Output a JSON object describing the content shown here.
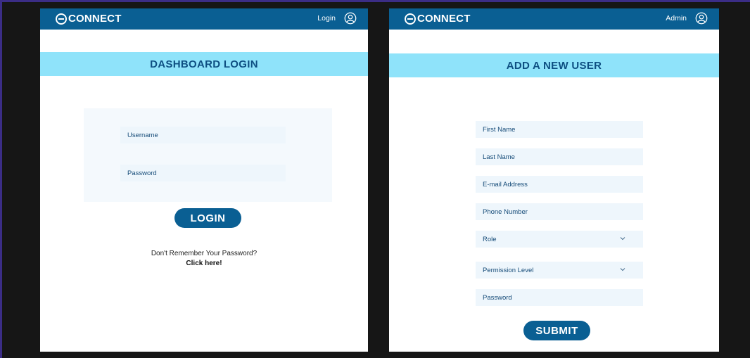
{
  "brand": {
    "logo_text": "CONNECT"
  },
  "login_screen": {
    "nav_label": "Login",
    "title": "DASHBOARD LOGIN",
    "username_placeholder": "Username",
    "password_placeholder": "Password",
    "login_button": "LOGIN",
    "forgot_prompt": "Don't Remember Your Password?",
    "forgot_link": "Click here!"
  },
  "add_user_screen": {
    "nav_label": "Admin",
    "title": "ADD A NEW USER",
    "fields": [
      {
        "label": "First Name",
        "type": "text"
      },
      {
        "label": "Last Name",
        "type": "text"
      },
      {
        "label": "E-mail Address",
        "type": "text"
      },
      {
        "label": "Phone Number",
        "type": "text"
      },
      {
        "label": "Role",
        "type": "select"
      },
      {
        "label": "Permission Level",
        "type": "select"
      },
      {
        "label": "Password",
        "type": "text"
      }
    ],
    "submit_button": "SUBMIT"
  },
  "icons": {
    "user": "user-circle-icon",
    "chevron": "chevron-down-icon",
    "logo": "logo-mark-icon"
  },
  "colors": {
    "navbar": "#0a5f93",
    "title_band": "#8fe3fa",
    "title_text": "#0e4f82",
    "field_bg": "#eef6fc",
    "background": "#161616"
  }
}
